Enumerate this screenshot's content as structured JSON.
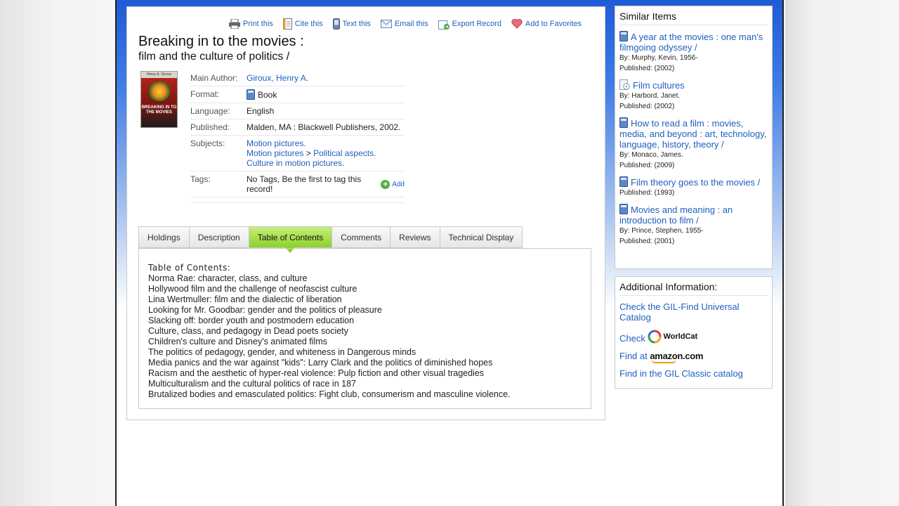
{
  "toolbar": {
    "print": "Print this",
    "cite": "Cite this",
    "text": "Text this",
    "email": "Email this",
    "export": "Export Record",
    "favorites": "Add to Favorites"
  },
  "record": {
    "title": "Breaking in to the movies :",
    "subtitle": "film and the culture of politics /",
    "cover": {
      "author": "Henry A. Giroux",
      "title": "BREAKING IN TO THE MOVIES"
    },
    "main_author_label": "Main Author:",
    "main_author": "Giroux, Henry A.",
    "format_label": "Format:",
    "format": "Book",
    "language_label": "Language:",
    "language": "English",
    "published_label": "Published:",
    "published": "Malden, MA : Blackwell Publishers, 2002.",
    "subjects_label": "Subjects:",
    "subjects": {
      "s1": "Motion pictures.",
      "s2a": "Motion pictures",
      "s2sep": " > ",
      "s2b": "Political aspects.",
      "s3": "Culture in motion pictures."
    },
    "tags_label": "Tags:",
    "tags_text": "No Tags, Be the first to tag this record!",
    "add_tag": "Add"
  },
  "tabs": [
    "Holdings",
    "Description",
    "Table of Contents",
    "Comments",
    "Reviews",
    "Technical Display"
  ],
  "toc": {
    "heading": "Table of Contents:",
    "items": [
      "Norma Rae: character, class, and culture",
      "Hollywood film and the challenge of neofascist culture",
      "Lina Wertmuller: film and the dialectic of liberation",
      "Looking for Mr. Goodbar: gender and the politics of pleasure",
      "Slacking off: border youth and postmodern education",
      "Culture, class, and pedagogy in Dead poets society",
      "Children's culture and Disney's animated films",
      "The politics of pedagogy, gender, and whiteness in Dangerous minds",
      "Media panics and the war against \"kids\": Larry Clark and the politics of diminished hopes",
      "Racism and the aesthetic of hyper-real violence: Pulp fiction and other visual tragedies",
      "Multiculturalism and the cultural politics of race in 187",
      "Brutalized bodies and emasculated politics: Fight club, consumerism and masculine violence."
    ]
  },
  "similar": {
    "title": "Similar Items",
    "items": [
      {
        "title": "A year at the movies : one man's filmgoing odyssey /",
        "by": "By: Murphy, Kevin, 1956-",
        "published": "Published: (2002)",
        "icon": "book-icon"
      },
      {
        "title": "Film cultures",
        "by": "By: Harbord, Janet.",
        "published": "Published: (2002)",
        "icon": "ebook-icon"
      },
      {
        "title": "How to read a film : movies, media, and beyond : art, technology, language, history, theory /",
        "by": "By: Monaco, James.",
        "published": "Published: (2009)",
        "icon": "book-icon"
      },
      {
        "title": "Film theory goes to the movies /",
        "by": "",
        "published": "Published: (1993)",
        "icon": "book-icon"
      },
      {
        "title": "Movies and meaning : an introduction to film /",
        "by": "By: Prince, Stephen, 1955-",
        "published": "Published: (2001)",
        "icon": "book-icon"
      }
    ]
  },
  "additional": {
    "title": "Additional Information:",
    "gil_find": "Check the GIL-Find Universal Catalog",
    "check": "Check",
    "worldcat": "WorldCat",
    "find_at": "Find at",
    "amazon": "amazon.com",
    "gil_classic": "Find in the GIL Classic catalog"
  }
}
